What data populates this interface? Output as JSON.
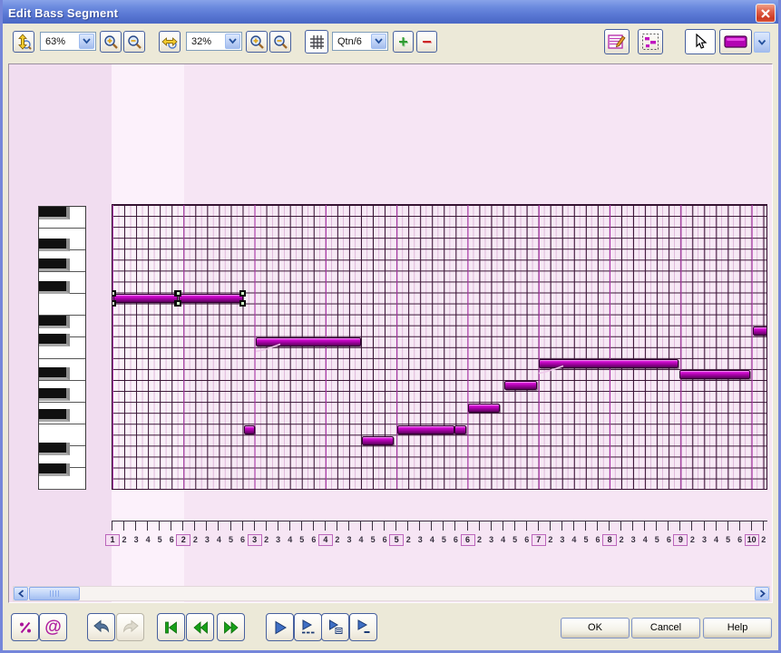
{
  "window": {
    "title": "Edit Bass Segment"
  },
  "toolbar": {
    "vertical_zoom_value": "63%",
    "horizontal_zoom_value": "32%",
    "grid_resolution_value": "Qtn/6",
    "add_label": "+",
    "remove_label": "−"
  },
  "icons": {
    "at_sign": "@"
  },
  "timeline": {
    "bar_numbers": [
      "1",
      "2",
      "3",
      "4",
      "5",
      "6",
      "7",
      "8",
      "9",
      "10"
    ],
    "beat_labels": [
      "2",
      "3",
      "4",
      "5",
      "6"
    ]
  },
  "piano_roll": {
    "rows": 26,
    "beats_per_bar": 6,
    "visible_beats": 55,
    "notes": [
      {
        "start": 0.05,
        "length": 5.5,
        "row": 8,
        "selected": true
      },
      {
        "start": 5.62,
        "length": 5.4,
        "row": 8,
        "selected": true
      },
      {
        "start": 12.1,
        "length": 8.9,
        "row": 12,
        "curve": true
      },
      {
        "start": 11.1,
        "length": 0.95,
        "row": 20
      },
      {
        "start": 21.05,
        "length": 2.7,
        "row": 21
      },
      {
        "start": 24.05,
        "length": 4.85,
        "row": 20
      },
      {
        "start": 28.9,
        "length": 1.0,
        "row": 20
      },
      {
        "start": 30.0,
        "length": 2.7,
        "row": 18
      },
      {
        "start": 33.1,
        "length": 2.8,
        "row": 16
      },
      {
        "start": 36.0,
        "length": 11.8,
        "row": 14,
        "curve": true
      },
      {
        "start": 47.9,
        "length": 6.0,
        "row": 15
      },
      {
        "start": 54.1,
        "length": 1.3,
        "row": 11
      }
    ]
  },
  "buttons": {
    "ok": "OK",
    "cancel": "Cancel",
    "help": "Help"
  },
  "colors": {
    "note": "#b303b3",
    "bar_line": "#b43ab2",
    "titlebar": "#5b7ad4",
    "selection_handle": "#cff5c8",
    "dialog_bg": "#ece9d8",
    "content_bg": "#f6e5f4"
  }
}
